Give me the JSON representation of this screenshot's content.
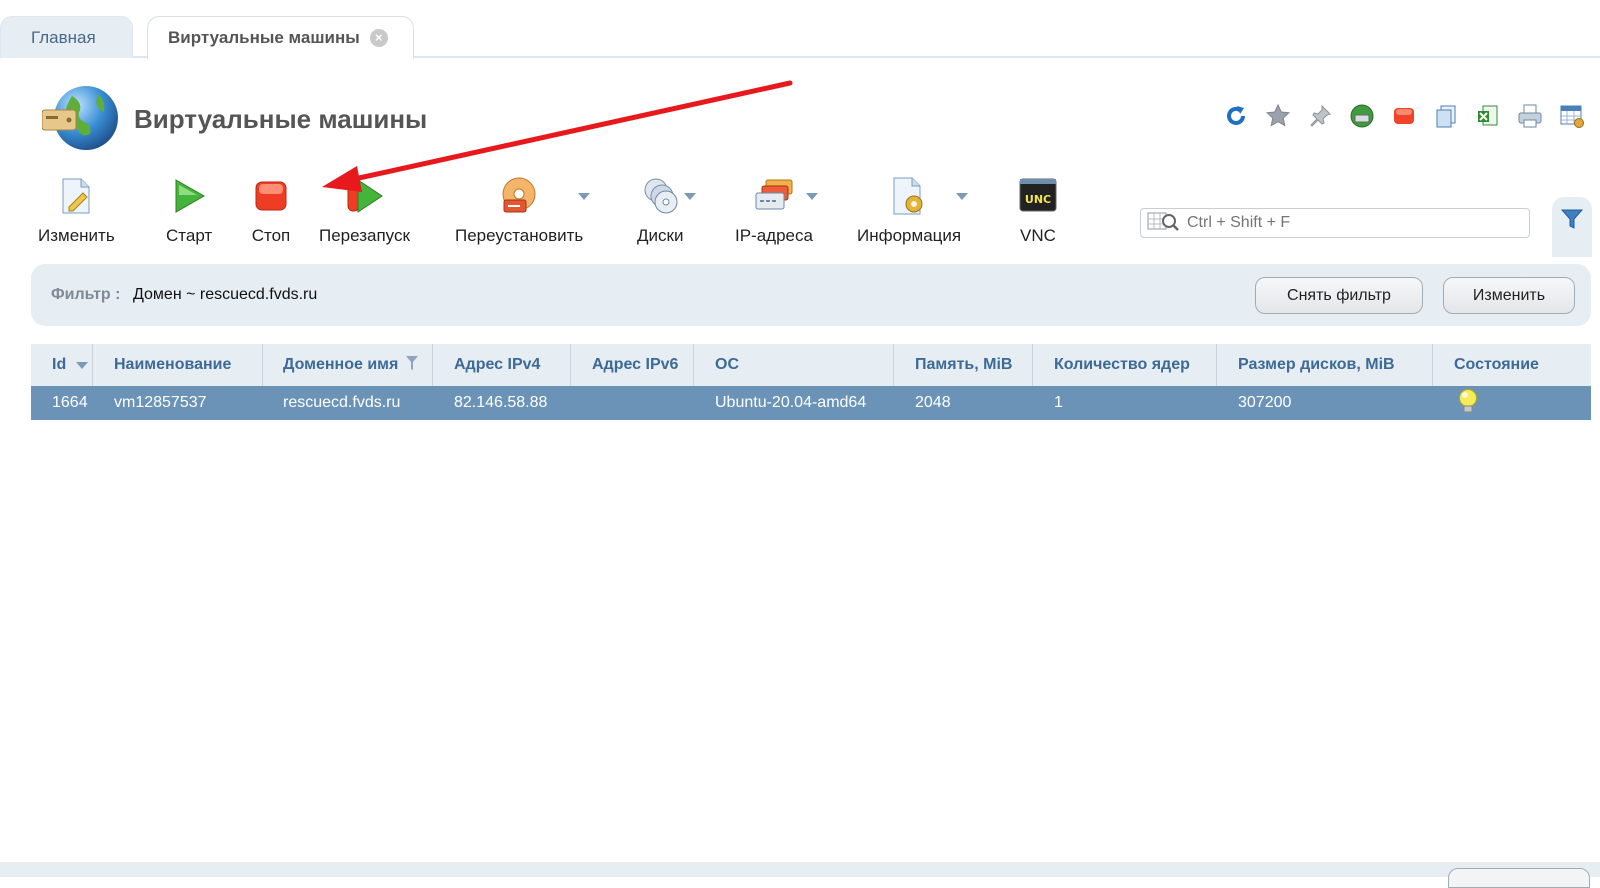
{
  "tabs": [
    {
      "label": "Главная",
      "active": false
    },
    {
      "label": "Виртуальные машины",
      "active": true
    }
  ],
  "page": {
    "title": "Виртуальные машины"
  },
  "toolbar": {
    "edit": "Изменить",
    "start": "Старт",
    "stop": "Стоп",
    "restart": "Перезапуск",
    "reinstall": "Переустановить",
    "disks": "Диски",
    "ip": "IP-адреса",
    "info": "Информация",
    "vnc": "VNC"
  },
  "search": {
    "placeholder": "Ctrl + Shift + F"
  },
  "filter": {
    "label": "Фильтр :",
    "value": "Домен ~ rescuecd.fvds.ru",
    "clear_label": "Снять фильтр",
    "edit_label": "Изменить"
  },
  "table": {
    "headers": [
      "Id",
      "Наименование",
      "Доменное имя",
      "Адрес IPv4",
      "Адрес IPv6",
      "ОС",
      "Память, MiB",
      "Количество ядер",
      "Размер дисков, MiB",
      "Состояние"
    ],
    "rows": [
      {
        "id": "1664",
        "name": "vm12857537",
        "domain": "rescuecd.fvds.ru",
        "ipv4": "82.146.58.88",
        "ipv6": "",
        "os": "Ubuntu-20.04-amd64",
        "memory": "2048",
        "cores": "1",
        "disk": "307200",
        "state_icon": "lightbulb-icon"
      }
    ]
  },
  "colors": {
    "accent": "#3d6a96",
    "selected_row": "#6b93b8",
    "panel": "#e6edf3",
    "arrow": "#e8191c"
  }
}
